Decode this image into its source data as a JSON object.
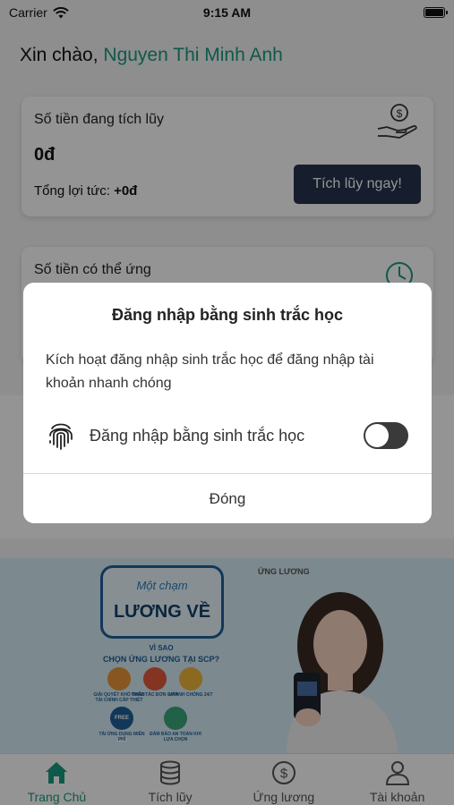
{
  "status": {
    "carrier": "Carrier",
    "time": "9:15 AM",
    "battery_level": 1.0
  },
  "greeting": {
    "prefix": "Xin chào,",
    "name": "Nguyen Thi Minh Anh"
  },
  "savings_card": {
    "title": "Số tiền đang tích lũy",
    "amount": "0đ",
    "interest_label": "Tổng lợi tức:",
    "interest_value": "+0đ",
    "button_label": "Tích lũy ngay!",
    "icon": "hand-coin-icon"
  },
  "advance_card": {
    "title": "Số tiền có thể ứng",
    "icon": "clock-icon"
  },
  "banner": {
    "brand": "ỨNG LƯƠNG",
    "line1": "Một chạm",
    "line2": "LƯƠNG VỀ",
    "why1": "VÌ SAO",
    "why2": "CHỌN ỨNG LƯƠNG TẠI SCP?",
    "features": [
      "GIẢI QUYẾT KHÓ KHĂN TÀI CHÍNH CẤP THIẾT",
      "THAO TÁC ĐƠN GIẢN",
      "NHANH CHÓNG 24/7",
      "TẢI ỨNG DỤNG MIỄN PHÍ",
      "ĐẢM BẢO AN TOÀN KHI LỰA CHỌN"
    ],
    "free_app_badge": "FREE APP"
  },
  "tabs": [
    {
      "label": "Trang Chủ",
      "icon": "home-icon",
      "active": true
    },
    {
      "label": "Tích lũy",
      "icon": "database-icon",
      "active": false
    },
    {
      "label": "Ứng lương",
      "icon": "dollar-circle-icon",
      "active": false
    },
    {
      "label": "Tài khoản",
      "icon": "user-icon",
      "active": false
    }
  ],
  "modal": {
    "title": "Đăng nhập bằng sinh trắc học",
    "description": "Kích hoạt đăng nhập sinh trắc học để đăng nhập tài khoản nhanh chóng",
    "toggle_label": "Đăng nhập bằng sinh trắc học",
    "toggle_on": false,
    "close_label": "Đóng"
  },
  "colors": {
    "accent": "#1a9a80",
    "button_dark": "#27324d"
  }
}
